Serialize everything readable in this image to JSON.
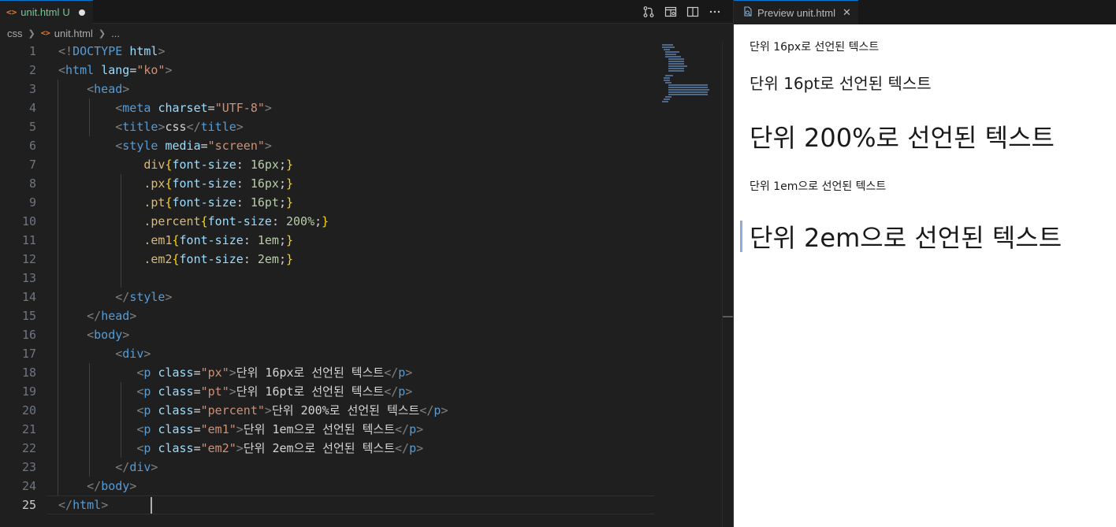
{
  "editor": {
    "tab": {
      "icon": "html-file-icon",
      "filename": "unit.html",
      "badge": "U"
    },
    "actions": [
      "source-control-icon",
      "open-preview-icon",
      "split-editor-icon",
      "more-actions-icon"
    ],
    "breadcrumb": {
      "folder": "css",
      "file": "unit.html",
      "tail": "..."
    },
    "line_numbers": [
      "1",
      "2",
      "3",
      "4",
      "5",
      "6",
      "7",
      "8",
      "9",
      "10",
      "11",
      "12",
      "13",
      "14",
      "15",
      "16",
      "17",
      "18",
      "19",
      "20",
      "21",
      "22",
      "23",
      "24",
      "25"
    ],
    "current_line": "25",
    "code_lines": [
      [
        [
          "br",
          "<!"
        ],
        [
          "tag",
          "DOCTYPE"
        ],
        [
          "txt",
          " "
        ],
        [
          "attr",
          "html"
        ],
        [
          "br",
          ">"
        ]
      ],
      [
        [
          "br",
          "<"
        ],
        [
          "tag",
          "html"
        ],
        [
          "txt",
          " "
        ],
        [
          "attr",
          "lang"
        ],
        [
          "txt",
          "="
        ],
        [
          "str",
          "\"ko\""
        ],
        [
          "br",
          ">"
        ]
      ],
      [
        [
          "txt",
          "    "
        ],
        [
          "br",
          "<"
        ],
        [
          "tag",
          "head"
        ],
        [
          "br",
          ">"
        ]
      ],
      [
        [
          "txt",
          "        "
        ],
        [
          "br",
          "<"
        ],
        [
          "tag",
          "meta"
        ],
        [
          "txt",
          " "
        ],
        [
          "attr",
          "charset"
        ],
        [
          "txt",
          "="
        ],
        [
          "str",
          "\"UTF-8\""
        ],
        [
          "br",
          ">"
        ]
      ],
      [
        [
          "txt",
          "        "
        ],
        [
          "br",
          "<"
        ],
        [
          "tag",
          "title"
        ],
        [
          "br",
          ">"
        ],
        [
          "txt",
          "css"
        ],
        [
          "br",
          "</"
        ],
        [
          "tag",
          "title"
        ],
        [
          "br",
          ">"
        ]
      ],
      [
        [
          "txt",
          "        "
        ],
        [
          "br",
          "<"
        ],
        [
          "tag",
          "style"
        ],
        [
          "txt",
          " "
        ],
        [
          "attr",
          "media"
        ],
        [
          "txt",
          "="
        ],
        [
          "str",
          "\"screen\""
        ],
        [
          "br",
          ">"
        ]
      ],
      [
        [
          "txt",
          "            "
        ],
        [
          "sel",
          "div"
        ],
        [
          "brace",
          "{"
        ],
        [
          "prop",
          "font-size"
        ],
        [
          "txt",
          ": "
        ],
        [
          "num",
          "16px"
        ],
        [
          "txt",
          ";"
        ],
        [
          "brace",
          "}"
        ]
      ],
      [
        [
          "txt",
          "            "
        ],
        [
          "sel",
          ".px"
        ],
        [
          "brace",
          "{"
        ],
        [
          "prop",
          "font-size"
        ],
        [
          "txt",
          ": "
        ],
        [
          "num",
          "16px"
        ],
        [
          "txt",
          ";"
        ],
        [
          "brace",
          "}"
        ]
      ],
      [
        [
          "txt",
          "            "
        ],
        [
          "sel",
          ".pt"
        ],
        [
          "brace",
          "{"
        ],
        [
          "prop",
          "font-size"
        ],
        [
          "txt",
          ": "
        ],
        [
          "num",
          "16pt"
        ],
        [
          "txt",
          ";"
        ],
        [
          "brace",
          "}"
        ]
      ],
      [
        [
          "txt",
          "            "
        ],
        [
          "sel",
          ".percent"
        ],
        [
          "brace",
          "{"
        ],
        [
          "prop",
          "font-size"
        ],
        [
          "txt",
          ": "
        ],
        [
          "num",
          "200%"
        ],
        [
          "txt",
          ";"
        ],
        [
          "brace",
          "}"
        ]
      ],
      [
        [
          "txt",
          "            "
        ],
        [
          "sel",
          ".em1"
        ],
        [
          "brace",
          "{"
        ],
        [
          "prop",
          "font-size"
        ],
        [
          "txt",
          ": "
        ],
        [
          "num",
          "1em"
        ],
        [
          "txt",
          ";"
        ],
        [
          "brace",
          "}"
        ]
      ],
      [
        [
          "txt",
          "            "
        ],
        [
          "sel",
          ".em2"
        ],
        [
          "brace",
          "{"
        ],
        [
          "prop",
          "font-size"
        ],
        [
          "txt",
          ": "
        ],
        [
          "num",
          "2em"
        ],
        [
          "txt",
          ";"
        ],
        [
          "brace",
          "}"
        ]
      ],
      [],
      [
        [
          "txt",
          "        "
        ],
        [
          "br",
          "</"
        ],
        [
          "tag",
          "style"
        ],
        [
          "br",
          ">"
        ]
      ],
      [
        [
          "txt",
          "    "
        ],
        [
          "br",
          "</"
        ],
        [
          "tag",
          "head"
        ],
        [
          "br",
          ">"
        ]
      ],
      [
        [
          "txt",
          "    "
        ],
        [
          "br",
          "<"
        ],
        [
          "tag",
          "body"
        ],
        [
          "br",
          ">"
        ]
      ],
      [
        [
          "txt",
          "        "
        ],
        [
          "br",
          "<"
        ],
        [
          "tag",
          "div"
        ],
        [
          "br",
          ">"
        ]
      ],
      [
        [
          "txt",
          "           "
        ],
        [
          "br",
          "<"
        ],
        [
          "tag",
          "p"
        ],
        [
          "txt",
          " "
        ],
        [
          "attr",
          "class"
        ],
        [
          "txt",
          "="
        ],
        [
          "str",
          "\"px\""
        ],
        [
          "br",
          ">"
        ],
        [
          "txt",
          "단위 16px로 선언된 텍스트"
        ],
        [
          "br",
          "</"
        ],
        [
          "tag",
          "p"
        ],
        [
          "br",
          ">"
        ]
      ],
      [
        [
          "txt",
          "           "
        ],
        [
          "br",
          "<"
        ],
        [
          "tag",
          "p"
        ],
        [
          "txt",
          " "
        ],
        [
          "attr",
          "class"
        ],
        [
          "txt",
          "="
        ],
        [
          "str",
          "\"pt\""
        ],
        [
          "br",
          ">"
        ],
        [
          "txt",
          "단위 16pt로 선언된 텍스트"
        ],
        [
          "br",
          "</"
        ],
        [
          "tag",
          "p"
        ],
        [
          "br",
          ">"
        ]
      ],
      [
        [
          "txt",
          "           "
        ],
        [
          "br",
          "<"
        ],
        [
          "tag",
          "p"
        ],
        [
          "txt",
          " "
        ],
        [
          "attr",
          "class"
        ],
        [
          "txt",
          "="
        ],
        [
          "str",
          "\"percent\""
        ],
        [
          "br",
          ">"
        ],
        [
          "txt",
          "단위 200%로 선언된 텍스트"
        ],
        [
          "br",
          "</"
        ],
        [
          "tag",
          "p"
        ],
        [
          "br",
          ">"
        ]
      ],
      [
        [
          "txt",
          "           "
        ],
        [
          "br",
          "<"
        ],
        [
          "tag",
          "p"
        ],
        [
          "txt",
          " "
        ],
        [
          "attr",
          "class"
        ],
        [
          "txt",
          "="
        ],
        [
          "str",
          "\"em1\""
        ],
        [
          "br",
          ">"
        ],
        [
          "txt",
          "단위 1em으로 선언된 텍스트"
        ],
        [
          "br",
          "</"
        ],
        [
          "tag",
          "p"
        ],
        [
          "br",
          ">"
        ]
      ],
      [
        [
          "txt",
          "           "
        ],
        [
          "br",
          "<"
        ],
        [
          "tag",
          "p"
        ],
        [
          "txt",
          " "
        ],
        [
          "attr",
          "class"
        ],
        [
          "txt",
          "="
        ],
        [
          "str",
          "\"em2\""
        ],
        [
          "br",
          ">"
        ],
        [
          "txt",
          "단위 2em으로 선언된 텍스트"
        ],
        [
          "br",
          "</"
        ],
        [
          "tag",
          "p"
        ],
        [
          "br",
          ">"
        ]
      ],
      [
        [
          "txt",
          "        "
        ],
        [
          "br",
          "</"
        ],
        [
          "tag",
          "div"
        ],
        [
          "br",
          ">"
        ]
      ],
      [
        [
          "txt",
          "    "
        ],
        [
          "br",
          "</"
        ],
        [
          "tag",
          "body"
        ],
        [
          "br",
          ">"
        ]
      ],
      [
        [
          "br",
          "</"
        ],
        [
          "tag",
          "html"
        ],
        [
          "br",
          ">"
        ]
      ]
    ]
  },
  "preview": {
    "tab": {
      "icon": "preview-icon",
      "title": "Preview unit.html",
      "close": "✕"
    },
    "paragraphs": {
      "px": "단위 16px로 선언된 텍스트",
      "pt": "단위 16pt로 선언된 텍스트",
      "percent": "단위 200%로 선언된 텍스트",
      "em1": "단위 1em으로 선언된 텍스트",
      "em2": "단위 2em으로 선언된 텍스트"
    }
  }
}
